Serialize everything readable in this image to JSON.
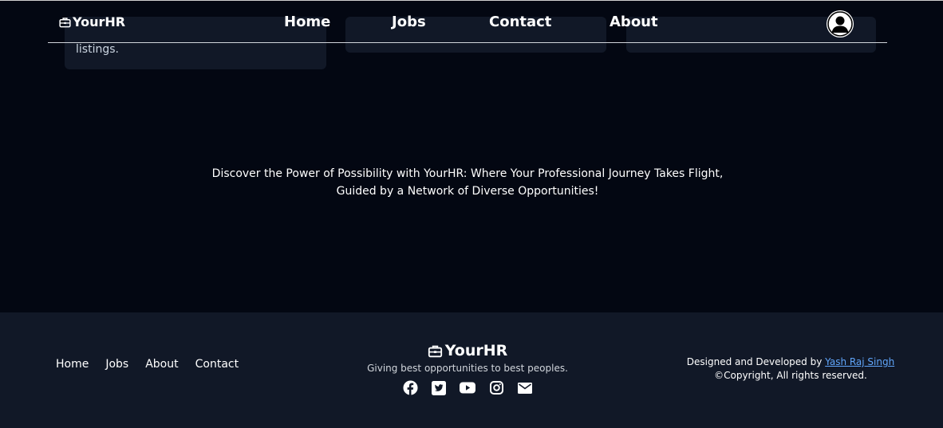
{
  "navbar": {
    "brand": "YourHR",
    "links": [
      "Home",
      "Jobs",
      "Contact",
      "About"
    ]
  },
  "cards": {
    "first_text": "listings."
  },
  "tagline": {
    "line1": "Discover the Power of Possibility with YourHR: Where Your Professional Journey Takes Flight,",
    "line2": "Guided by a Network of Diverse Opportunities!"
  },
  "footer": {
    "links": [
      "Home",
      "Jobs",
      "About",
      "Contact"
    ],
    "brand": "YourHR",
    "subtitle": "Giving best opportunities to best peoples.",
    "socials": [
      "facebook-icon",
      "twitter-icon",
      "youtube-icon",
      "instagram-icon",
      "mail-icon"
    ],
    "credit_prefix": "Designed and Developed by ",
    "credit_author": "Yash Raj Singh",
    "copyright": "©Copyright, All rights reserved."
  },
  "colors": {
    "background": "#030712",
    "footer": "#111827",
    "card": "#111827",
    "link": "#60a5fa"
  }
}
